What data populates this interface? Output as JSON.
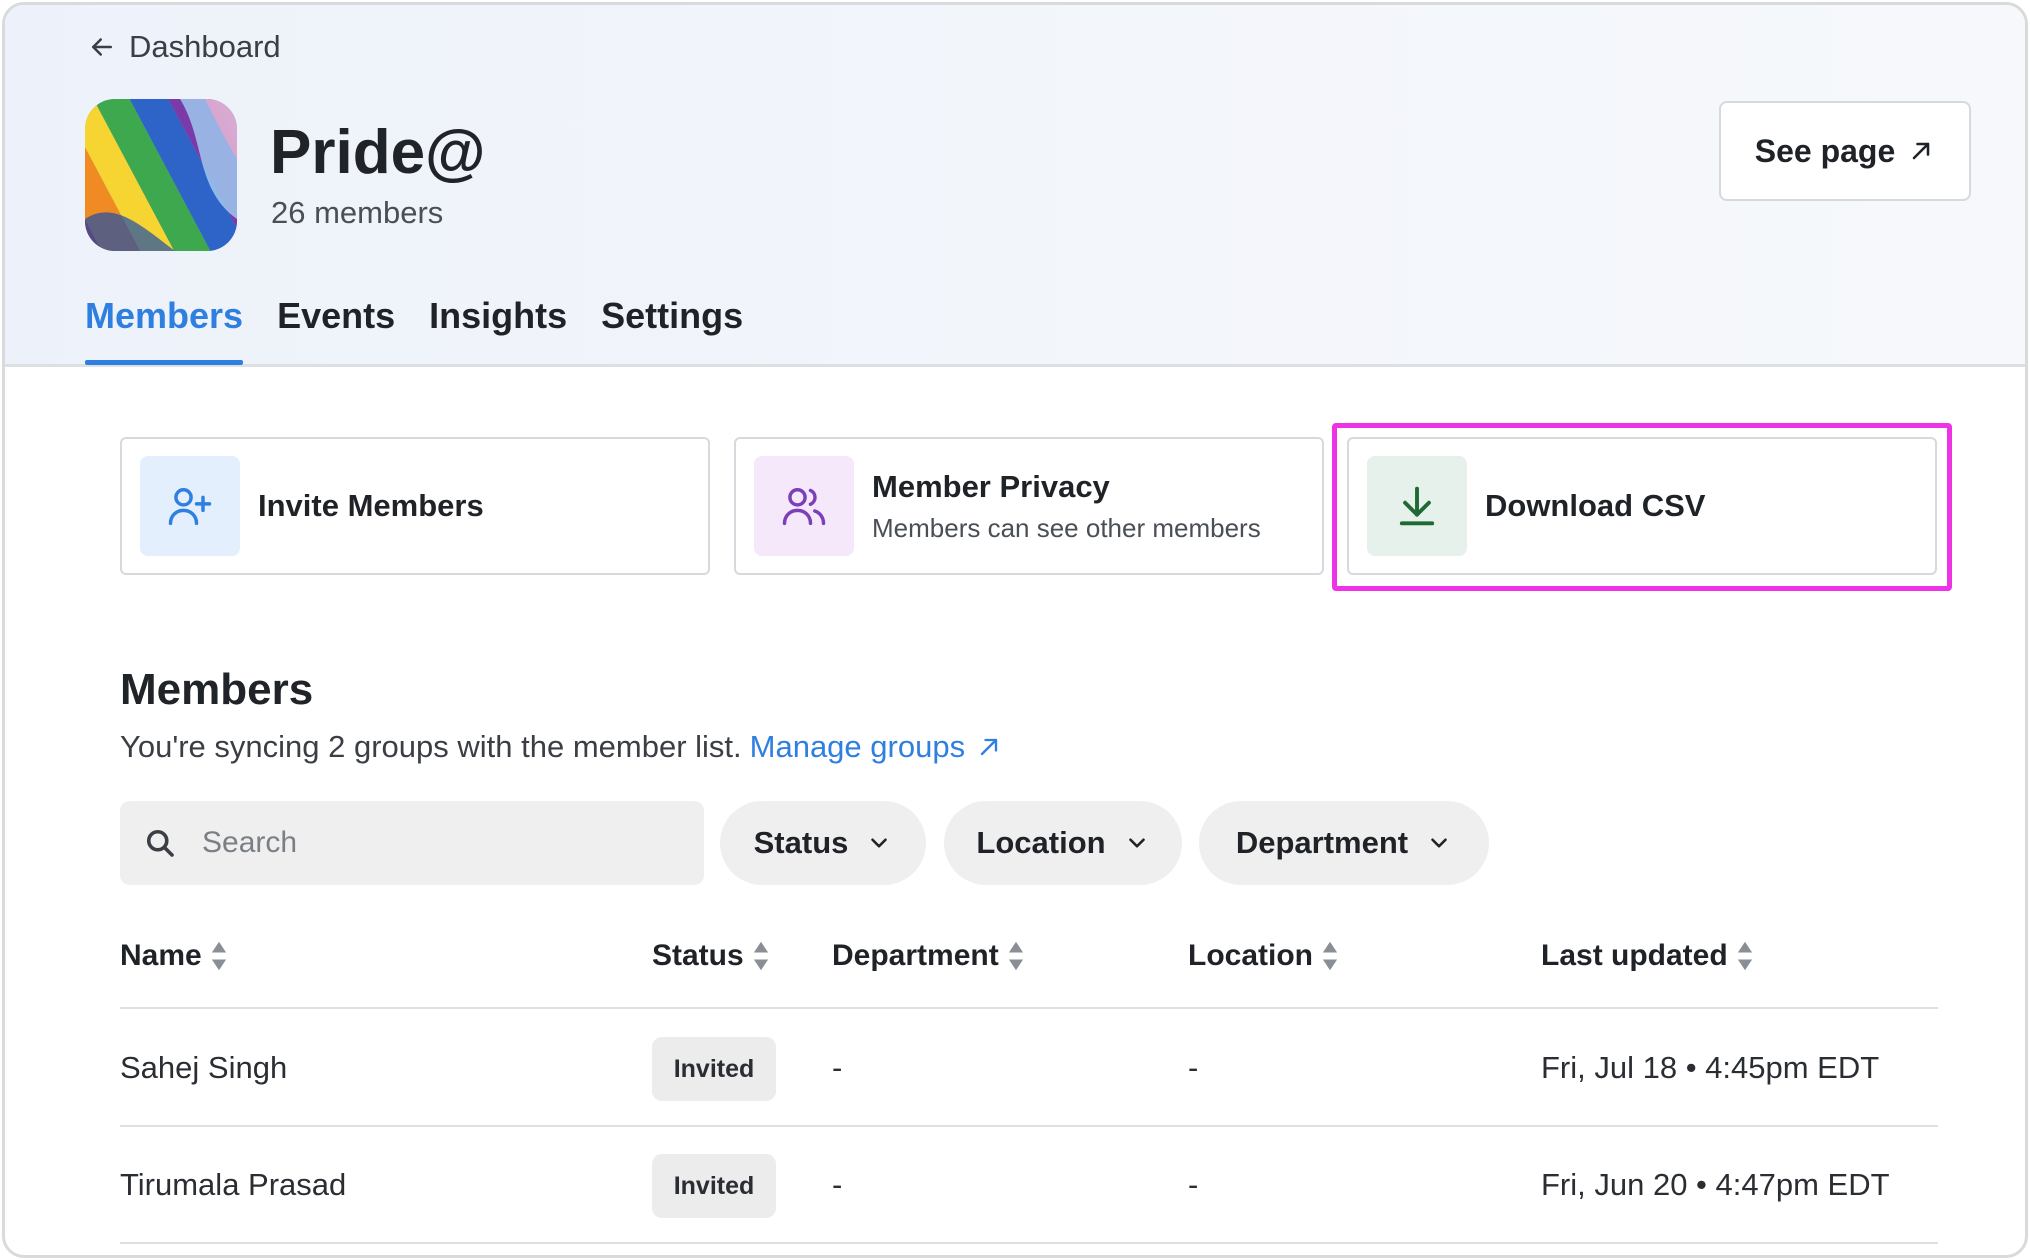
{
  "back_link": {
    "label": "Dashboard"
  },
  "group": {
    "name": "Pride@",
    "member_count": "26 members"
  },
  "see_page_button": {
    "label": "See page"
  },
  "tabs": [
    {
      "label": "Members",
      "active": true
    },
    {
      "label": "Events",
      "active": false
    },
    {
      "label": "Insights",
      "active": false
    },
    {
      "label": "Settings",
      "active": false
    }
  ],
  "cards": {
    "invite": {
      "label": "Invite Members",
      "icon": "user-plus-icon",
      "accent": "#2f7fe0",
      "bg": "#e3effc"
    },
    "privacy": {
      "label": "Member Privacy",
      "sub": "Members can see other members",
      "icon": "users-icon",
      "accent": "#7b3fb8",
      "bg": "#f5e8fb"
    },
    "download": {
      "label": "Download CSV",
      "icon": "download-icon",
      "accent": "#1f6a33",
      "bg": "#e5f1ea"
    }
  },
  "members_section": {
    "title": "Members",
    "description": "You're syncing 2 groups with the member list.",
    "manage_link": "Manage groups"
  },
  "search": {
    "placeholder": "Search",
    "value": ""
  },
  "filters": [
    {
      "label": "Status"
    },
    {
      "label": "Location"
    },
    {
      "label": "Department"
    }
  ],
  "table": {
    "columns": [
      "Name",
      "Status",
      "Department",
      "Location",
      "Last updated"
    ],
    "rows": [
      {
        "name": "Sahej Singh",
        "status": "Invited",
        "department": "-",
        "location": "-",
        "last_updated": "Fri, Jul 18 • 4:45pm EDT"
      },
      {
        "name": "Tirumala Prasad",
        "status": "Invited",
        "department": "-",
        "location": "-",
        "last_updated": "Fri, Jun 20 • 4:47pm EDT"
      }
    ]
  },
  "colors": {
    "accent_blue": "#2f7fe0",
    "highlight": "#ee32e6"
  }
}
